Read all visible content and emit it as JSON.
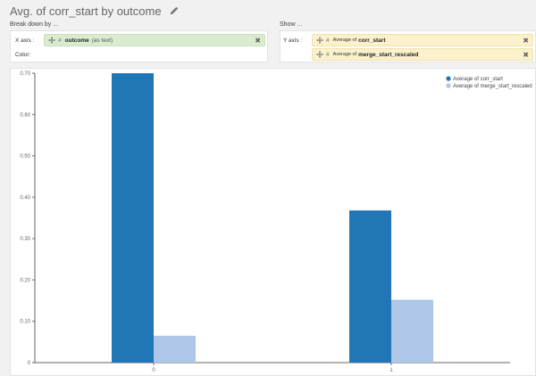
{
  "header": {
    "title": "Avg. of corr_start by outcome"
  },
  "breakdown": {
    "label": "Break down by ...",
    "x_axis_label": "X axis :",
    "x_field": {
      "name": "outcome",
      "type_note": "(as text)",
      "type_icon": "#"
    },
    "color_label": "Color:"
  },
  "show": {
    "label": "Show ...",
    "y_axis_label": "Y axis :",
    "y_fields": [
      {
        "prefix": "Average of",
        "name": "corr_start",
        "type_icon": "#"
      },
      {
        "prefix": "Average of",
        "name": "merge_start_rescaled",
        "type_icon": "#"
      }
    ]
  },
  "colors": {
    "series1": "#2176b5",
    "series2": "#aec7e8",
    "green_pill": "#d9ecd0",
    "yellow_pill": "#fbf1cc"
  },
  "chart_data": {
    "type": "bar",
    "categories": [
      "0",
      "1"
    ],
    "series": [
      {
        "name": "Average of corr_start",
        "values": [
          0.7,
          0.368
        ],
        "color": "#2176b5"
      },
      {
        "name": "Average of merge_start_rescaled",
        "values": [
          0.065,
          0.152
        ],
        "color": "#aec7e8"
      }
    ],
    "ylim": [
      0,
      0.7
    ],
    "yticks": [
      0,
      0.1,
      0.2,
      0.3,
      0.4,
      0.5,
      0.6,
      0.7
    ],
    "ytick_labels": [
      "0",
      "0.10",
      "0.20",
      "0.30",
      "0.40",
      "0.50",
      "0.60",
      "0.70"
    ],
    "grid": false,
    "legend": "top-right"
  }
}
